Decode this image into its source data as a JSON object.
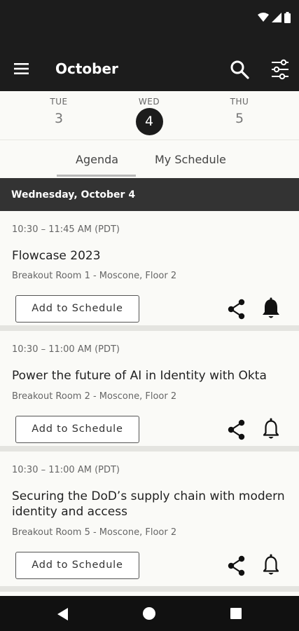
{
  "app_bar": {
    "title": "October"
  },
  "dates": [
    {
      "dow": "TUE",
      "num": "3"
    },
    {
      "dow": "WED",
      "num": "4"
    },
    {
      "dow": "THU",
      "num": "5"
    }
  ],
  "tabs": [
    {
      "label": "Agenda"
    },
    {
      "label": "My Schedule"
    }
  ],
  "day_header": "Wednesday, October 4",
  "sessions": [
    {
      "time": "10:30 – 11:45 AM (PDT)",
      "title": "Flowcase 2023",
      "room": "Breakout Room 1 - Moscone, Floor 2",
      "add_label": "Add to Schedule",
      "bell": "bell-filled-icon"
    },
    {
      "time": "10:30 – 11:00 AM (PDT)",
      "title": "Power the future of AI in Identity with Okta",
      "room": "Breakout Room 2 - Moscone, Floor 2",
      "add_label": "Add to Schedule",
      "bell": "bell-outline-icon"
    },
    {
      "time": "10:30 – 11:00 AM (PDT)",
      "title": "Securing the DoD’s supply chain with modern identity and access",
      "room": "Breakout Room 5 - Moscone, Floor 2",
      "add_label": "Add to Schedule",
      "bell": "bell-outline-icon"
    }
  ]
}
